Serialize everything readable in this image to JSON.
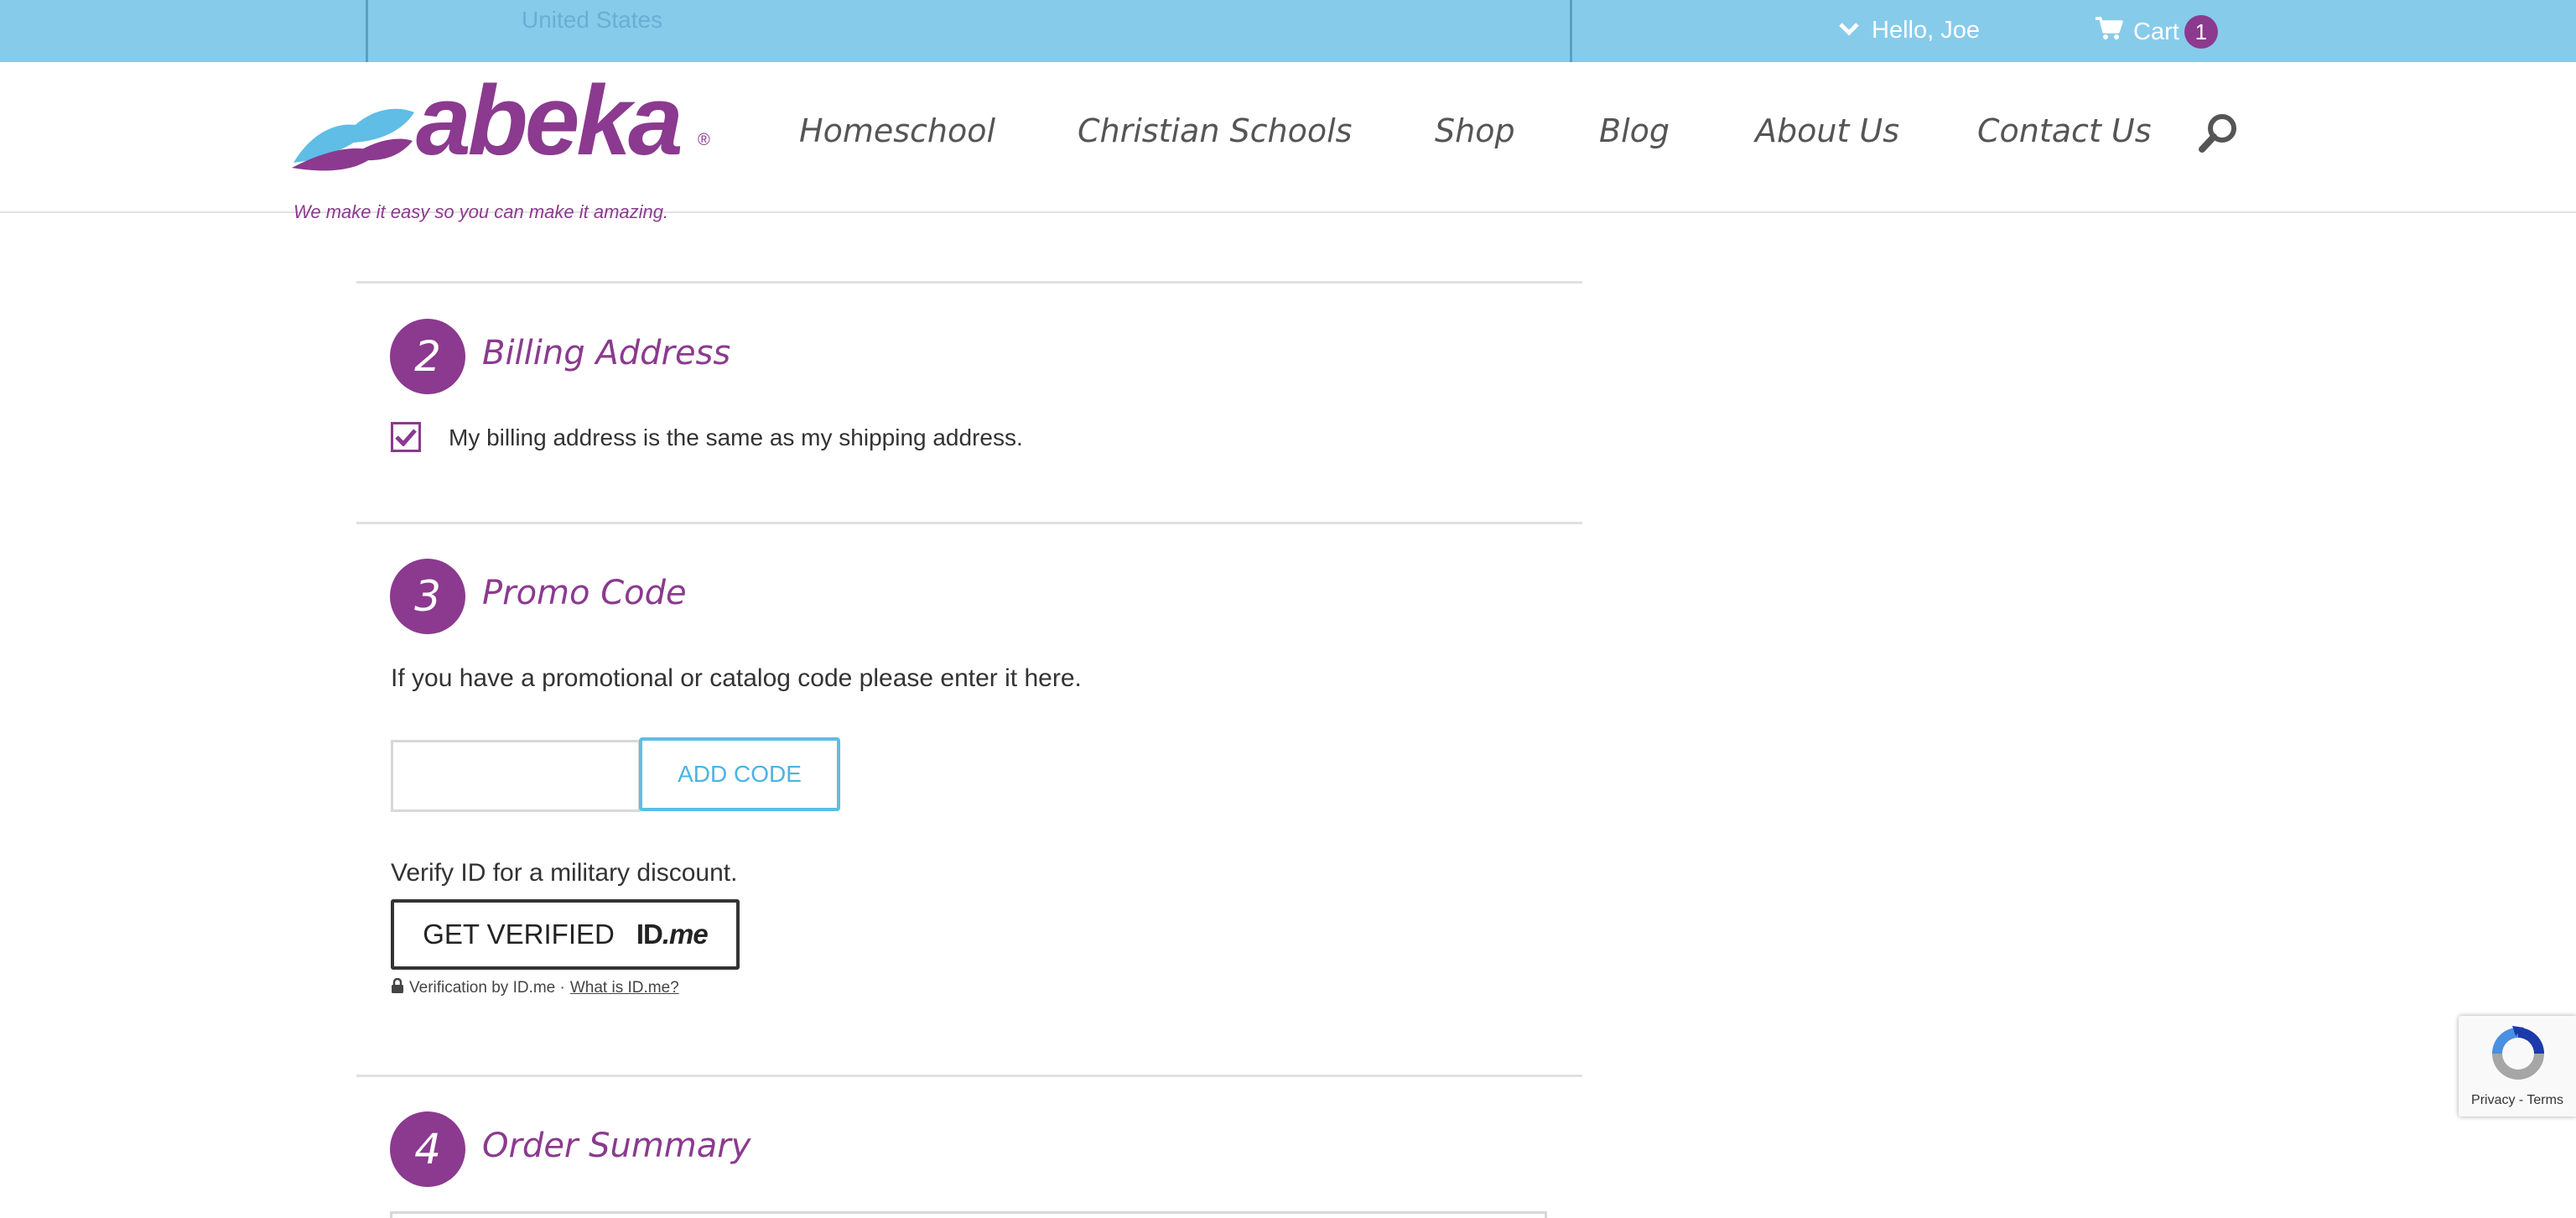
{
  "topbar": {
    "country": "United States",
    "user_greeting": "Hello, Joe",
    "cart_label": "Cart",
    "cart_count": "1"
  },
  "header": {
    "logo_text": "abeka",
    "logo_reg": "®",
    "tagline": "We make it easy so you can make it amazing.",
    "nav": [
      "Homeschool",
      "Christian Schools",
      "Shop",
      "Blog",
      "About Us",
      "Contact Us"
    ]
  },
  "billing": {
    "step": "2",
    "title": "Billing Address",
    "same_as_shipping_label": "My billing address is the same as my shipping address.",
    "same_as_shipping_checked": true
  },
  "promo": {
    "step": "3",
    "title": "Promo Code",
    "instructions": "If you have a promotional or catalog code please enter it here.",
    "input_value": "",
    "add_button": "ADD CODE",
    "military_text": "Verify ID for a military discount.",
    "idme_button": "GET VERIFIED",
    "idme_logo_id": "ID",
    "idme_logo_me": ".me",
    "verification_note": "Verification by ID.me ·",
    "what_is_link": "What is ID.me?"
  },
  "order_summary": {
    "step": "4",
    "title": "Order Summary"
  },
  "recaptcha": {
    "privacy": "Privacy",
    "separator": "-",
    "terms": "Terms"
  },
  "colors": {
    "brand_purple": "#8b3a8f",
    "topbar_blue": "#87cbeb",
    "accent_blue": "#5fbde6"
  }
}
